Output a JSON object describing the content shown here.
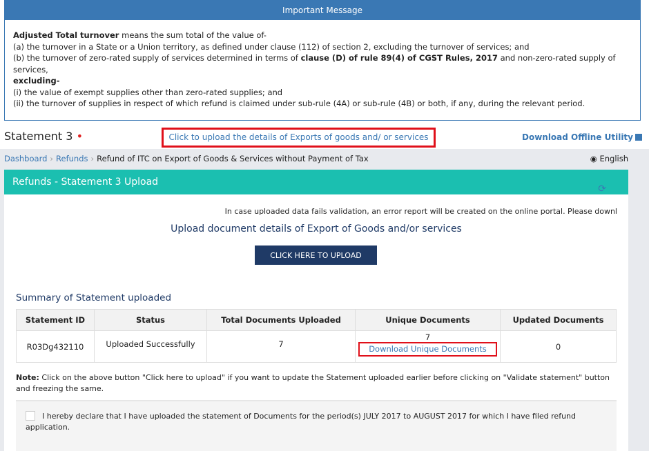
{
  "message": {
    "title": "Important Message",
    "line1_bold": "Adjusted Total turnover",
    "line1_rest": " means the sum total of the value of-",
    "line2": "(a) the turnover in a State or a Union territory, as defined under clause (112) of section 2, excluding the turnover of services; and",
    "line3_pre": "(b) the turnover of zero-rated supply of services determined in terms of ",
    "line3_bold": "clause (D) of rule 89(4) of CGST Rules, 2017",
    "line3_post": " and non-zero-rated supply of services,",
    "excluding": "excluding-",
    "line4": "(i) the value of exempt supplies other than zero-rated supplies; and",
    "line5": "(ii) the turnover of supplies in respect of which refund is claimed under sub-rule (4A) or sub-rule (4B) or both, if any, during the relevant period."
  },
  "statement": {
    "label": "Statement 3",
    "required": "•",
    "upload_link": "Click to upload the details of Exports of goods and/ or services",
    "offline": "Download Offline Utility"
  },
  "breadcrumb": {
    "items": [
      "Dashboard",
      "Refunds"
    ],
    "current": "Refund of ITC on Export of Goods & Services without Payment of Tax",
    "language": "English"
  },
  "panel": {
    "title": "Refunds - Statement 3 Upload",
    "info": "In case uploaded data fails validation, an error report will be created on the online portal. Please downl",
    "upload_title": "Upload document details of Export of Goods and/or services",
    "upload_button": "CLICK HERE TO UPLOAD",
    "summary_title": "Summary of Statement uploaded",
    "columns": [
      "Statement ID",
      "Status",
      "Total Documents Uploaded",
      "Unique Documents",
      "Updated Documents"
    ],
    "row": {
      "id": "R03Dg432110",
      "status": "Uploaded Successfully",
      "total": "7",
      "unique": "7",
      "unique_link": "Download Unique Documents",
      "updated": "0"
    },
    "note_label": "Note:",
    "note": " Click on the above button \"Click here to upload\" if you want to update the Statement uploaded earlier before clicking on \"Validate statement\" button and freezing the same.",
    "declaration": {
      "pre": "I hereby declare that I have uploaded the statement of Documents for the period(s) ",
      "from": "JULY 2017",
      "to_word": " to ",
      "to": "AUGUST 2017",
      "post": " for which I have filed refund application."
    }
  }
}
